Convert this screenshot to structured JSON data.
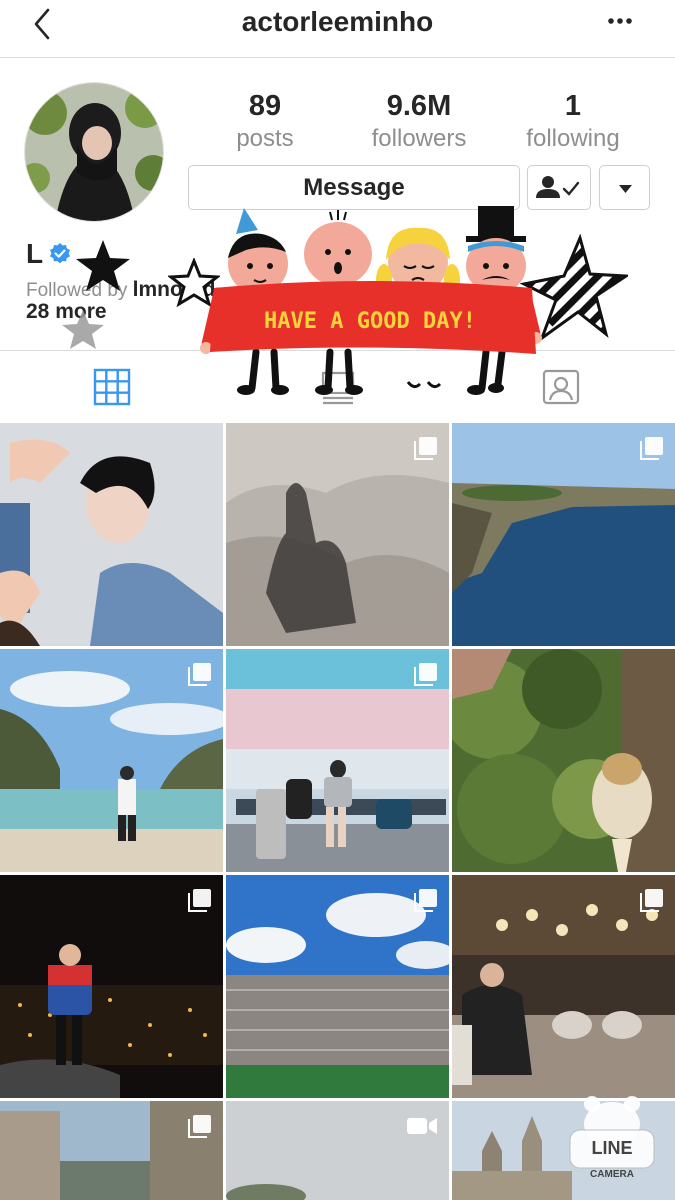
{
  "header": {
    "username": "actorleeminho"
  },
  "stats": [
    {
      "count": "89",
      "label": "posts"
    },
    {
      "count": "9.6M",
      "label": "followers"
    },
    {
      "count": "1",
      "label": "following"
    }
  ],
  "actions": {
    "message_label": "Message"
  },
  "profile": {
    "name": "L",
    "followed_by_prefix": "Followed by ",
    "followed_by_user": "lmnootd",
    "followed_by_more": "28 more"
  },
  "sticker": {
    "banner_text": "HAVE A GOOD DAY!",
    "watermark_top": "LINE",
    "watermark_bottom": "CAMERA"
  },
  "icons": {
    "back": "chevron-left-icon",
    "more": "ellipsis-icon",
    "following": "person-check-icon",
    "dropdown": "caret-down-icon",
    "verified": "verified-badge-icon",
    "grid_tab": "grid-icon",
    "list_tab": "list-icon",
    "feed_tab": "feed-icon",
    "tagged_tab": "tagged-icon",
    "multi_post": "multiple-photos-icon",
    "video_post": "video-icon"
  },
  "colors": {
    "accent": "#3897f0",
    "banner_red": "#e8302a",
    "banner_text": "#f7d43a"
  },
  "posts": [
    {
      "scene": "portrait",
      "multi": false
    },
    {
      "scene": "shadow-rock",
      "multi": true
    },
    {
      "scene": "coast",
      "multi": true
    },
    {
      "scene": "beach-man",
      "multi": true
    },
    {
      "scene": "airport",
      "multi": true
    },
    {
      "scene": "forest-flowers",
      "multi": false
    },
    {
      "scene": "night-city",
      "multi": true
    },
    {
      "scene": "stadium",
      "multi": true
    },
    {
      "scene": "cafe",
      "multi": true
    },
    {
      "scene": "street-buildings",
      "multi": true
    },
    {
      "scene": "sky-video",
      "video": true
    },
    {
      "scene": "cathedral",
      "multi": true
    }
  ]
}
